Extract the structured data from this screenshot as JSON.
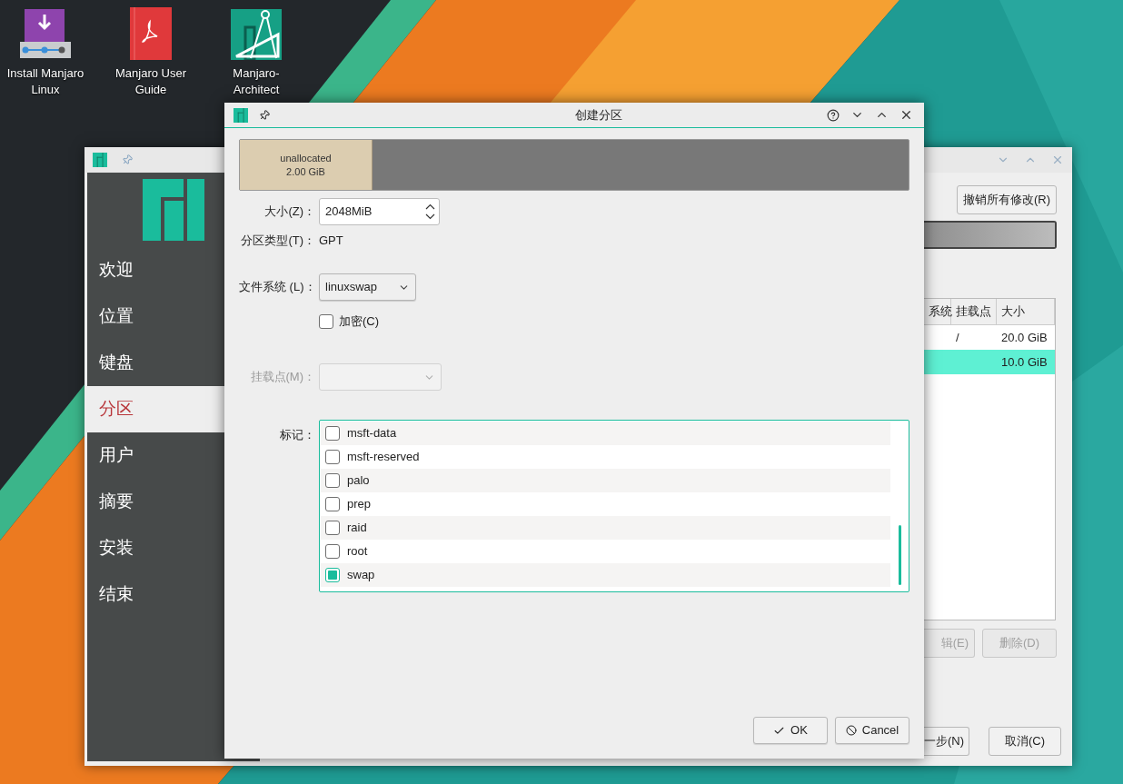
{
  "desktop_icons": [
    {
      "kind": "installer",
      "label": "Install Manjaro Linux"
    },
    {
      "kind": "guide",
      "label": "Manjaro User Guide"
    },
    {
      "kind": "architect",
      "label": "Manjaro-Architect"
    }
  ],
  "installer_window": {
    "sidebar_items": [
      {
        "label": "欢迎",
        "selected": false
      },
      {
        "label": "位置",
        "selected": false
      },
      {
        "label": "键盘",
        "selected": false
      },
      {
        "label": "分区",
        "selected": true
      },
      {
        "label": "用户",
        "selected": false
      },
      {
        "label": "摘要",
        "selected": false
      },
      {
        "label": "安装",
        "selected": false
      },
      {
        "label": "结束",
        "selected": false
      }
    ],
    "revert_button": "撤销所有修改(R)",
    "partition_table": {
      "columns": [
        "系统",
        "挂载点",
        "大小"
      ],
      "rows": [
        {
          "mount": "/",
          "size": "20.0 GiB",
          "selected": false
        },
        {
          "size": "10.0 GiB",
          "selected": true
        }
      ]
    },
    "action_buttons": [
      {
        "label": "辑(E)",
        "disabled": true
      },
      {
        "label": "删除(D)",
        "disabled": true
      }
    ],
    "nav_buttons": [
      {
        "label": "一步(N)"
      },
      {
        "label": "取消(C)"
      }
    ]
  },
  "dialog": {
    "title": "创建分区",
    "partition_bar": {
      "label": "unallocated",
      "size": "2.00 GiB"
    },
    "size": {
      "label": "大小(Z)：",
      "value": "2048MiB"
    },
    "partition_type": {
      "label": "分区类型(T)：",
      "value": "GPT"
    },
    "filesystem": {
      "label": "文件系统 (L)：",
      "value": "linuxswap"
    },
    "encrypt": {
      "label": "加密(C)",
      "checked": false
    },
    "mount_point": {
      "label": "挂载点(M)：",
      "disabled": true
    },
    "flags": {
      "label": "标记：",
      "items": [
        {
          "label": "msft-data",
          "checked": false
        },
        {
          "label": "msft-reserved",
          "checked": false
        },
        {
          "label": "palo",
          "checked": false
        },
        {
          "label": "prep",
          "checked": false
        },
        {
          "label": "raid",
          "checked": false
        },
        {
          "label": "root",
          "checked": false
        },
        {
          "label": "swap",
          "checked": true
        }
      ]
    },
    "buttons": [
      {
        "kind": "ok",
        "label": "OK"
      },
      {
        "kind": "cancel",
        "label": "Cancel"
      }
    ]
  }
}
